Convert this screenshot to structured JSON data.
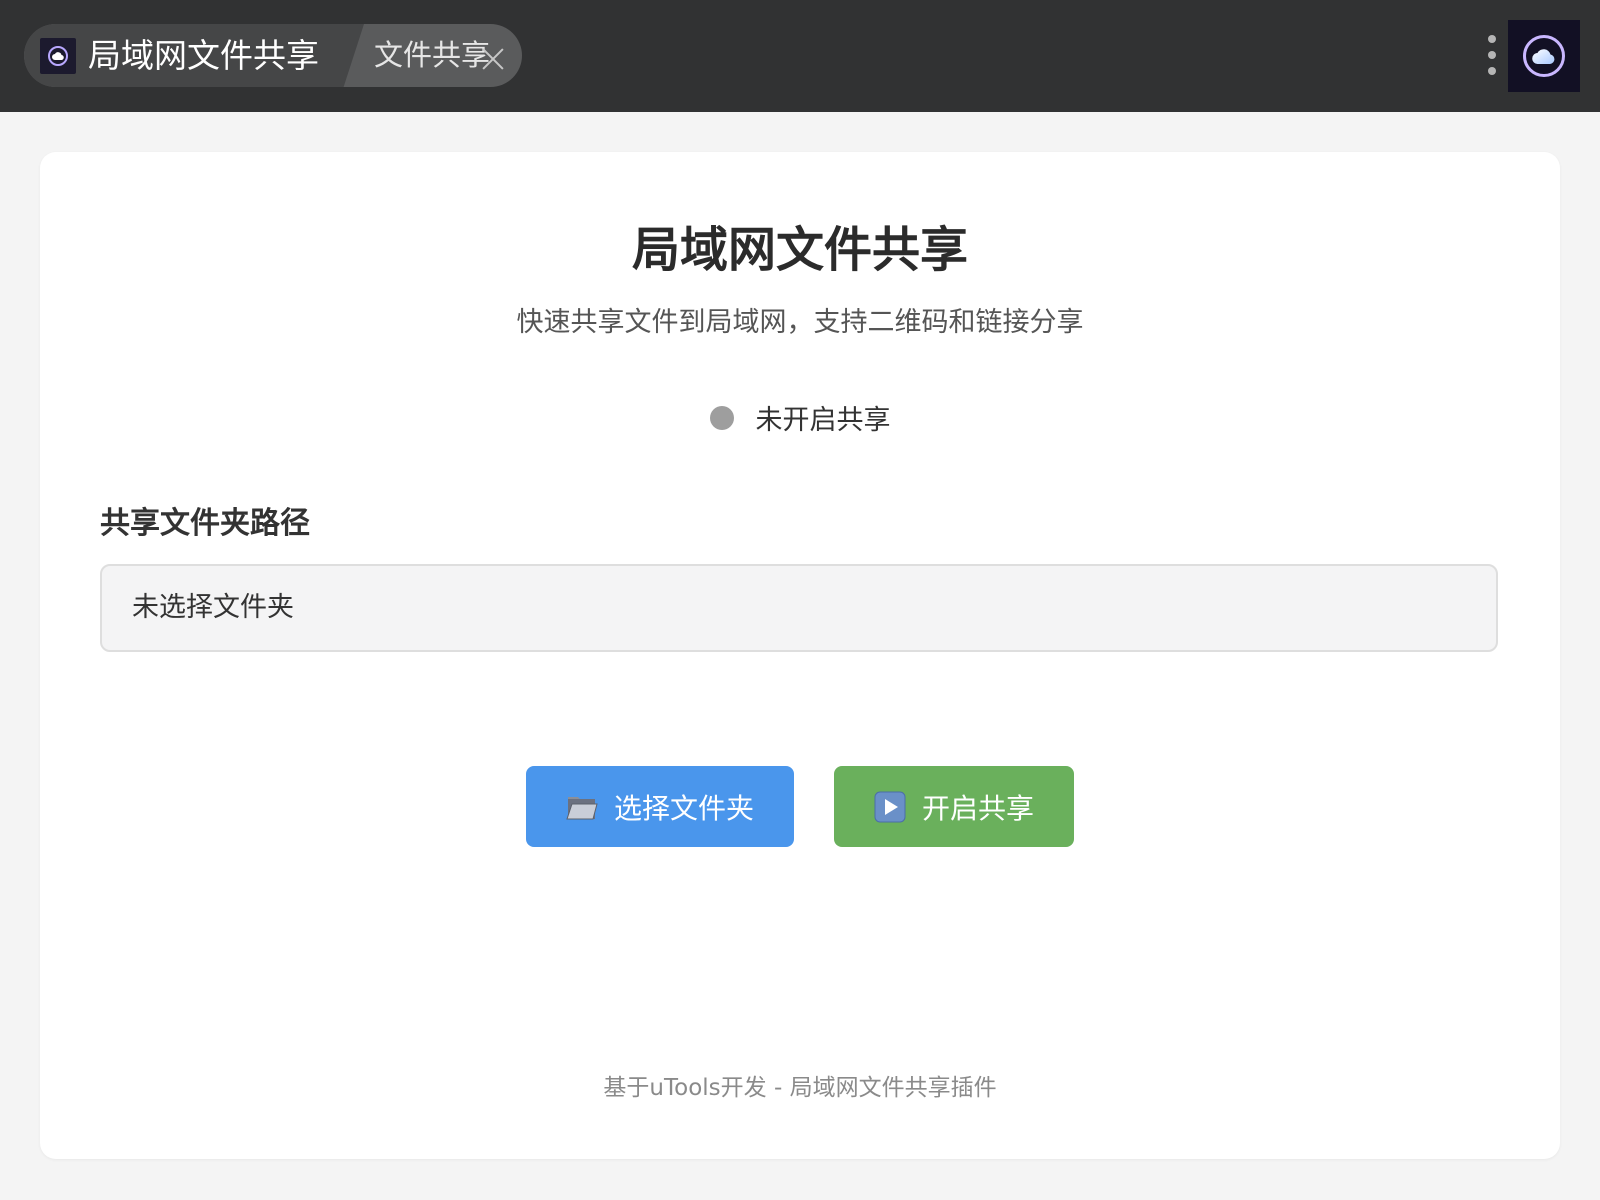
{
  "titlebar": {
    "tab_title": "局域网文件共享",
    "sub_tab_title": "文件共享",
    "app_icon": "cloud-icon",
    "close_icon": "close-icon",
    "menu_icon": "more-vertical-icon",
    "plugin_logo_icon": "cloud-icon"
  },
  "main": {
    "title": "局域网文件共享",
    "subtitle": "快速共享文件到局域网，支持二维码和链接分享",
    "status": {
      "text": "未开启共享",
      "color": "#9e9e9e"
    },
    "path": {
      "label": "共享文件夹路径",
      "value": "未选择文件夹"
    },
    "buttons": {
      "select_label": "选择文件夹",
      "select_icon": "folder-icon",
      "select_color": "#4a96ec",
      "start_label": "开启共享",
      "start_icon": "play-icon",
      "start_color": "#6ab05c"
    },
    "footer": "基于uTools开发 - 局域网文件共享插件"
  }
}
